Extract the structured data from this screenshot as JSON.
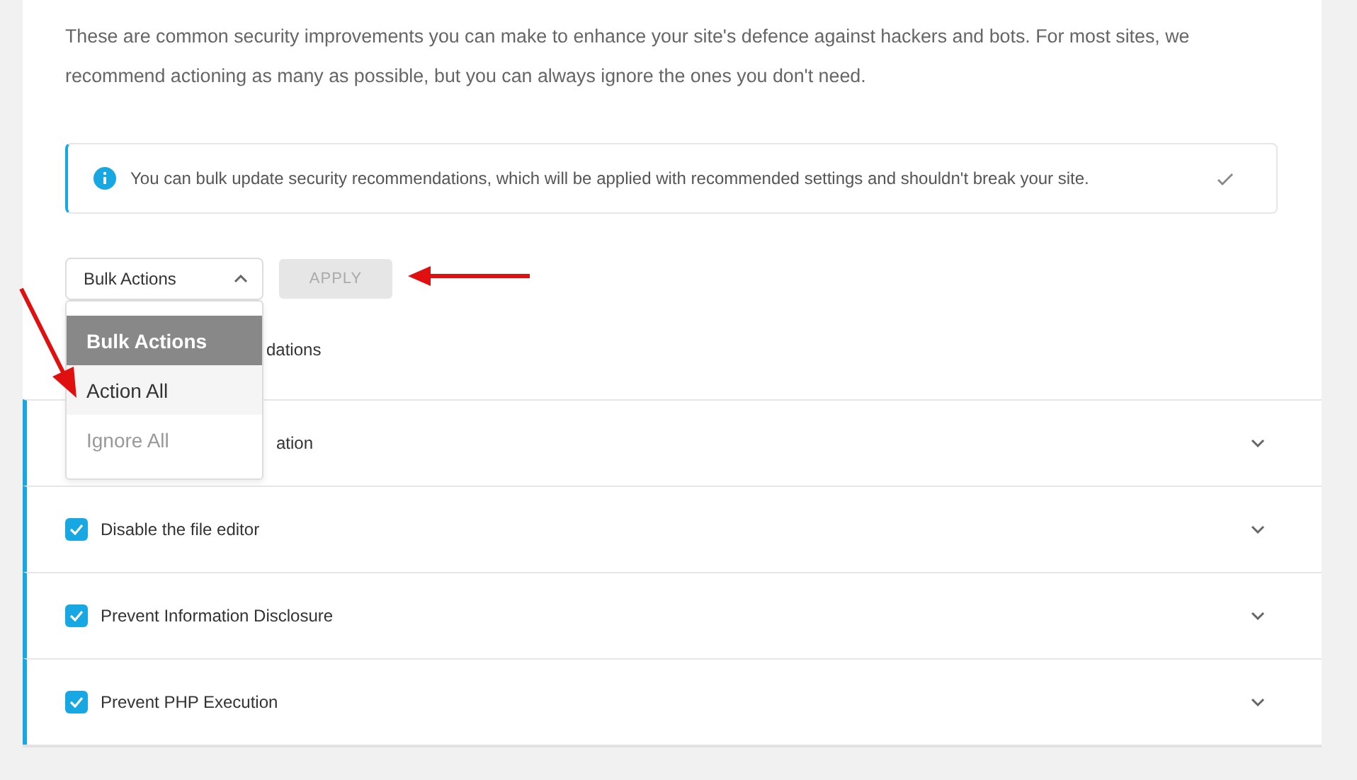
{
  "intro": "These are common security improvements you can make to enhance your site's defence against hackers and bots. For most sites, we recommend actioning as many as possible, but you can always ignore the ones you don't need.",
  "notice": {
    "text": "You can bulk update security recommendations, which will be applied with recommended settings and shouldn't break your site."
  },
  "bulk_select": {
    "value": "Bulk Actions",
    "expanded": true,
    "options": [
      {
        "label": "Bulk Actions",
        "selected": true,
        "disabled": false
      },
      {
        "label": "Action All",
        "selected": false,
        "disabled": false
      },
      {
        "label": "Ignore All",
        "selected": false,
        "disabled": true
      }
    ]
  },
  "apply_button": {
    "label": "APPLY",
    "disabled": true
  },
  "select_all_label": "dations",
  "recommendations": [
    {
      "label": "ation"
    },
    {
      "label": "Disable the file editor",
      "checked": true
    },
    {
      "label": "Prevent Information Disclosure",
      "checked": true
    },
    {
      "label": "Prevent PHP Execution",
      "checked": true
    }
  ]
}
